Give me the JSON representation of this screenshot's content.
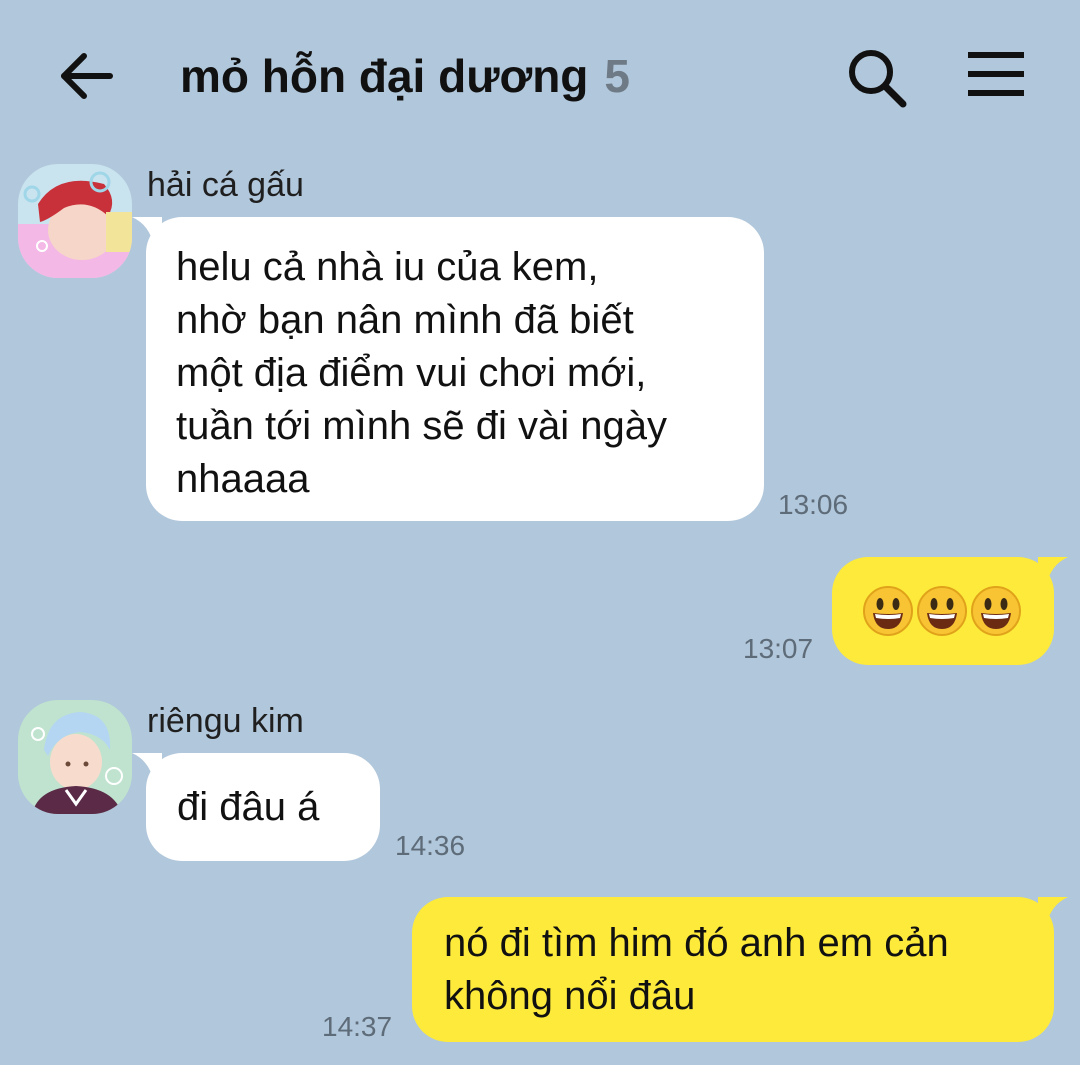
{
  "header": {
    "title": "mỏ hỗn đại dương",
    "member_count": "5",
    "back_icon": "arrow-left-icon",
    "search_icon": "search-icon",
    "menu_icon": "hamburger-menu-icon"
  },
  "messages": [
    {
      "direction": "incoming",
      "sender": "hải cá gấu",
      "lines": [
        "helu cả nhà iu của kem,",
        "nhờ bạn nân mình đã biết",
        "một địa điểm vui chơi mới,",
        "tuần tới mình sẽ đi vài ngày",
        "nhaaaa"
      ],
      "time": "13:06"
    },
    {
      "direction": "outgoing",
      "emojis": [
        "😀",
        "😀",
        "😀"
      ],
      "emoji_icon": "grinning-face-emoji-icon",
      "time": "13:07"
    },
    {
      "direction": "incoming",
      "sender": "riêngu kim",
      "lines": [
        "đi đâu á"
      ],
      "time": "14:36"
    },
    {
      "direction": "outgoing",
      "lines": [
        "nó đi tìm him đó anh em cản",
        "không nổi đâu"
      ],
      "time": "14:37"
    }
  ],
  "colors": {
    "background": "#b1c7db",
    "incoming_bubble": "#ffffff",
    "outgoing_bubble": "#fdea3b",
    "timestamp": "#5e6b78",
    "member_count": "#6e7a85"
  }
}
